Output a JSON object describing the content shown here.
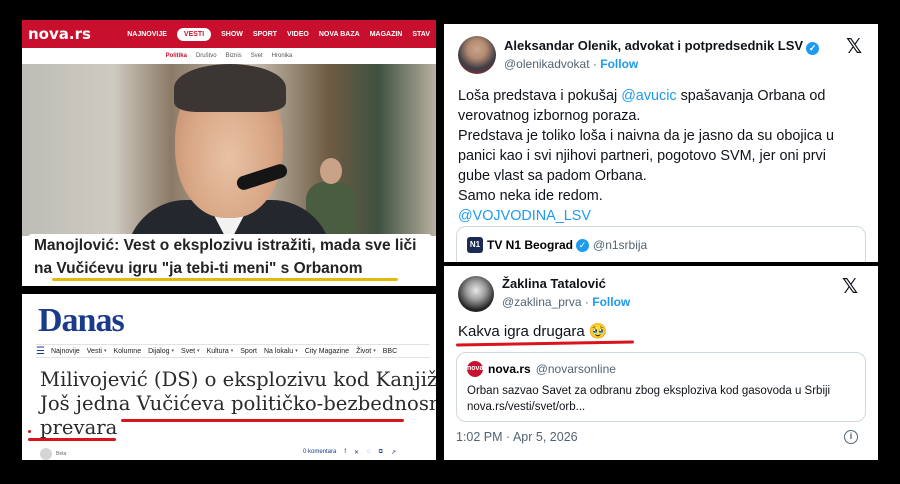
{
  "nova": {
    "logo": "nova.rs",
    "nav": [
      "NAJNOVIJE",
      "VESTI",
      "SHOW",
      "SPORT",
      "VIDEO",
      "NOVA BAZA",
      "MAGAZIN",
      "STAV"
    ],
    "active_nav": "VESTI",
    "subnav": [
      "Politika",
      "Društvo",
      "Biznis",
      "Svet",
      "Hronika"
    ],
    "headline_line1": "Manojlović: Vest o eksplozivu istražiti, mada sve liči",
    "headline_line2": "na Vučićevu igru \"ja tebi-ti meni\" s Orbanom"
  },
  "danas": {
    "logo": "Danas",
    "nav": [
      "Najnovije",
      "Vesti",
      "Kolumne",
      "Dijalog",
      "Svet",
      "Kultura",
      "Sport",
      "Na lokalu",
      "City Magazine",
      "Život",
      "BBC"
    ],
    "title_line1": "Milivojević (DS) o eksplozivu kod Kanjiže:",
    "title_line2": "Još jedna Vučićeva političko-bezbednosna",
    "title_line3": "prevara",
    "author": "Beta",
    "comments": "0 komentara"
  },
  "tweet1": {
    "name": "Aleksandar Olenik, advokat i potpredsednik LSV",
    "handle": "@olenikadvokat",
    "follow": "Follow",
    "body": {
      "l1a": "Loša predstava i pokušaj ",
      "l1m": "@avucic",
      "l1b": " spašavanja Orbana od",
      "l2": "verovatnog izbornog poraza.",
      "l3": "Predstava je toliko loša i naivna da je jasno da su obojica u",
      "l4": "panici kao i svi njihovi partneri, pogotovo SVM, jer oni prvi",
      "l5": "gube vlast sa padom Orbana.",
      "l6": "Samo neka ide redom.",
      "l7": "@VOJVODINA_LSV"
    },
    "quote_name": "TV N1 Beograd",
    "quote_handle": "@n1srbija",
    "quote_logo": "N1"
  },
  "tweet2": {
    "name": "Žaklina Tatalović",
    "handle": "@zaklina_prva",
    "follow": "Follow",
    "text": "Kakva igra drugara 🥹",
    "quote_name": "nova.rs",
    "quote_handle": "@novarsonline",
    "quote_logo": "nova",
    "quote_line1": "Orban sazvao Savet za odbranu zbog eksploziva kod gasovoda u Srbiji",
    "quote_line2": "nova.rs/vesti/svet/orb...",
    "time": "1:02 PM · Apr 5, 2026"
  },
  "icons": {
    "x": "𝕏",
    "verified": "✓",
    "info": "i",
    "menu": "☰"
  },
  "colors": {
    "nova_red": "#c8102e",
    "danas_blue": "#1a3a8a",
    "twitter_blue": "#1d9bf0",
    "underline_red": "#d9141c",
    "underline_yellow": "#e2b90c"
  }
}
